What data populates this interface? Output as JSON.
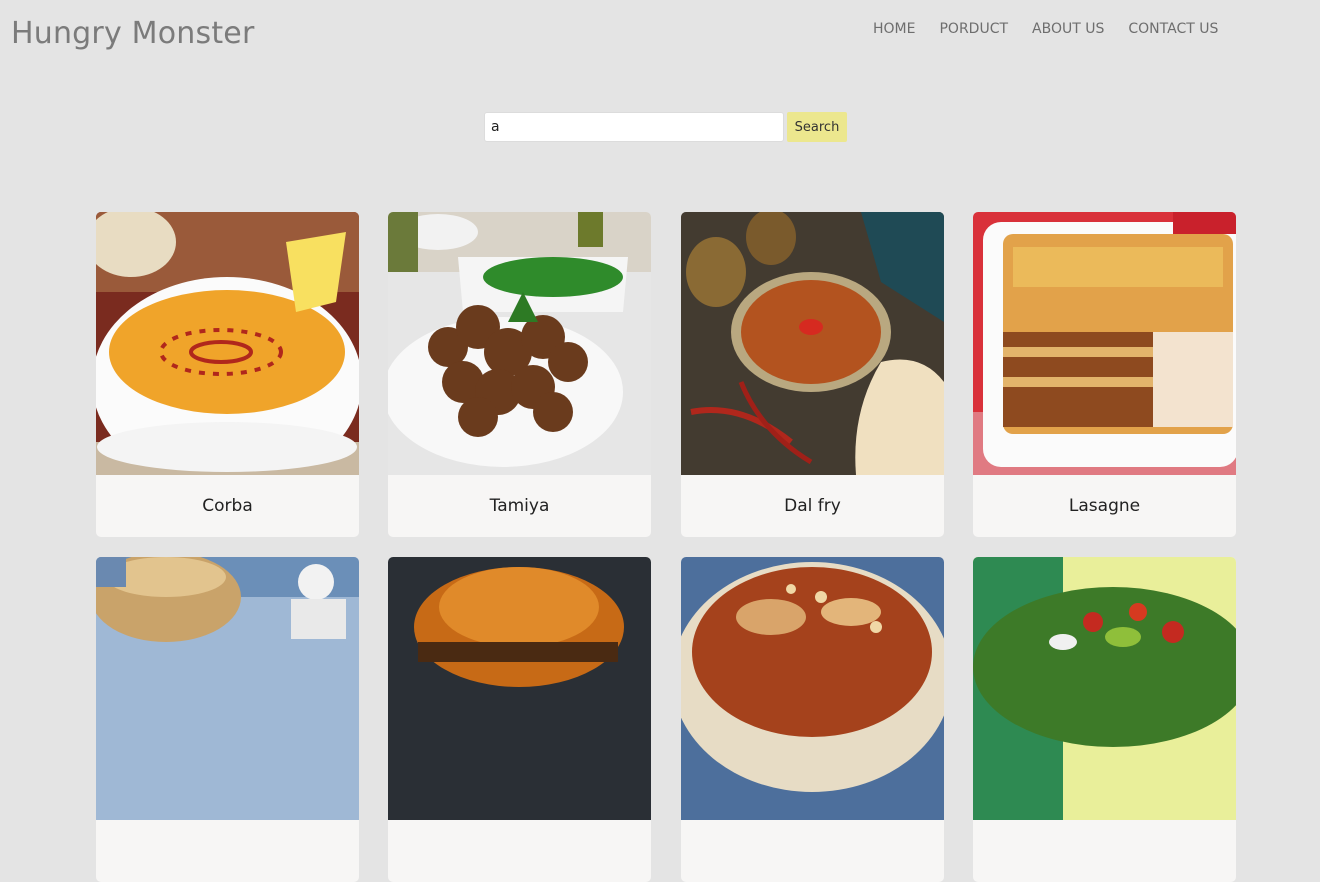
{
  "header": {
    "logo": "Hungry Monster",
    "nav": [
      {
        "label": "HOME"
      },
      {
        "label": "PORDUCT"
      },
      {
        "label": "ABOUT US"
      },
      {
        "label": "CONTACT US"
      }
    ]
  },
  "search": {
    "value": "a",
    "button_label": "Search"
  },
  "meals": [
    {
      "name": "Corba",
      "image": "corba-soup-image"
    },
    {
      "name": "Tamiya",
      "image": "tamiya-falafel-image"
    },
    {
      "name": "Dal fry",
      "image": "dal-fry-image"
    },
    {
      "name": "Lasagne",
      "image": "lasagne-image"
    },
    {
      "name": "",
      "image": "bread-basket-image"
    },
    {
      "name": "",
      "image": "burger-image"
    },
    {
      "name": "",
      "image": "koshari-image"
    },
    {
      "name": "",
      "image": "salad-image"
    }
  ],
  "colors": {
    "background": "#e4e4e4",
    "search_button": "#ece78e",
    "card": "#f7f6f5"
  }
}
